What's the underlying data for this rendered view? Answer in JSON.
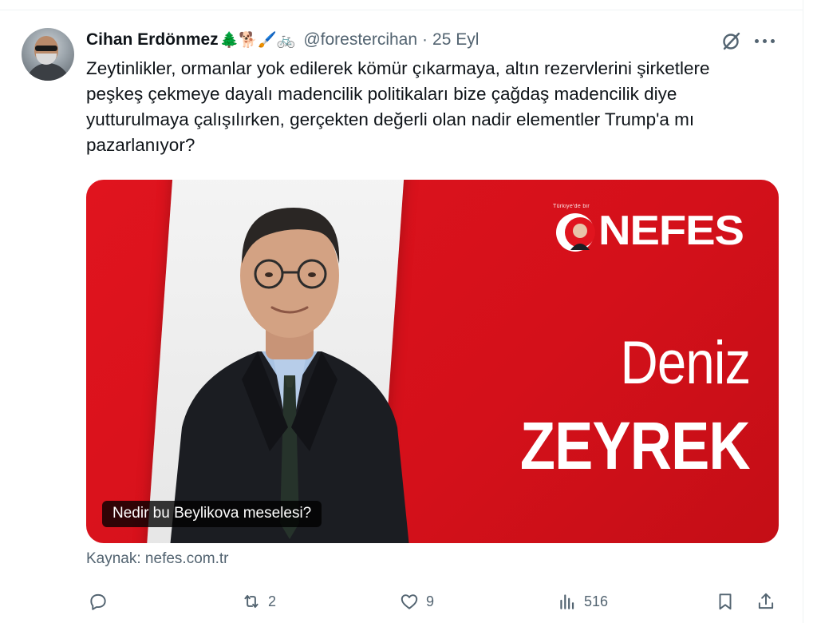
{
  "tweet": {
    "display_name": "Cihan Erdönmez",
    "name_emojis": "🌲🐕🖌️🚲",
    "handle": "@forestercihan",
    "separator": "·",
    "date": "25 Eyl",
    "text": "Zeytinlikler, ormanlar yok edilerek kömür çıkarmaya, altın rezervlerini şirketlere peşkeş çekmeye dayalı madencilik politikaları bize çağdaş madencilik diye yutturulmaya çalışılırken, gerçekten değerli olan nadir elementler Trump'a mı pazarlanıyor?",
    "icons": {
      "grok": "grok-icon",
      "more": "more-icon"
    }
  },
  "media": {
    "logo_tagline": "Türkiye'de bir",
    "logo_text": "NEFES",
    "first_name": "Deniz",
    "last_name": "ZEYREK",
    "caption": "Nedir bu Beylikova meselesi?",
    "bg_color": "#e0141e"
  },
  "source": {
    "label": "Kaynak: nefes.com.tr"
  },
  "actions": {
    "reply": {
      "icon": "reply-icon",
      "count": ""
    },
    "retweet": {
      "icon": "retweet-icon",
      "count": "2"
    },
    "like": {
      "icon": "like-icon",
      "count": "9"
    },
    "views": {
      "icon": "views-icon",
      "count": "516"
    },
    "bookmark": {
      "icon": "bookmark-icon"
    },
    "share": {
      "icon": "share-icon"
    }
  }
}
